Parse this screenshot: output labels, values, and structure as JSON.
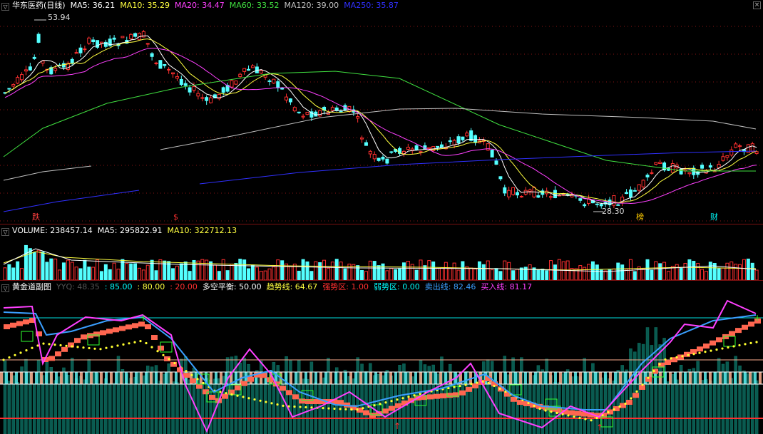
{
  "main": {
    "title": "华东医药(日线)",
    "mas": [
      {
        "label": "MA5: 36.21",
        "color": "#ffffff"
      },
      {
        "label": "MA10: 35.29",
        "color": "#ffff40"
      },
      {
        "label": "MA20: 34.47",
        "color": "#ff40ff"
      },
      {
        "label": "MA60: 33.52",
        "color": "#40e040"
      },
      {
        "label": "MA120: 39.00",
        "color": "#c0c0c0"
      },
      {
        "label": "MA250: 35.87",
        "color": "#3030ff"
      }
    ],
    "high_label": "53.94",
    "low_label": "28.30",
    "markers": [
      {
        "text": "跌",
        "color": "#ff4040"
      },
      {
        "text": "$",
        "color": "#ff3030"
      },
      {
        "text": "榜",
        "color": "#ffcc00"
      },
      {
        "text": "财",
        "color": "#00ffff"
      }
    ]
  },
  "volume": {
    "labels": [
      {
        "label": "VOLUME: 238457.14",
        "color": "#ffffff"
      },
      {
        "label": "MA5: 295822.91",
        "color": "#ffffff"
      },
      {
        "label": "MA10: 322712.13",
        "color": "#ffff40"
      }
    ]
  },
  "indicator": {
    "title": "黄金道副图",
    "labels": [
      {
        "label": "YYQ: 48.35",
        "color": "#555555"
      },
      {
        "label": ": 85.00",
        "color": "#00ffff"
      },
      {
        "label": ": 80.00",
        "color": "#ffff40"
      },
      {
        "label": ": 20.00",
        "color": "#ff3030"
      },
      {
        "label": "多空平衡: 50.00",
        "color": "#ffffff"
      },
      {
        "label": "趋势线: 64.67",
        "color": "#ffff40"
      },
      {
        "label": "强势区: 1.00",
        "color": "#ff3030"
      },
      {
        "label": "弱势区: 0.00",
        "color": "#00ffff"
      },
      {
        "label": "卖出线: 82.46",
        "color": "#3a9fff"
      },
      {
        "label": "买入线: 81.17",
        "color": "#ff40ff"
      }
    ]
  }
}
